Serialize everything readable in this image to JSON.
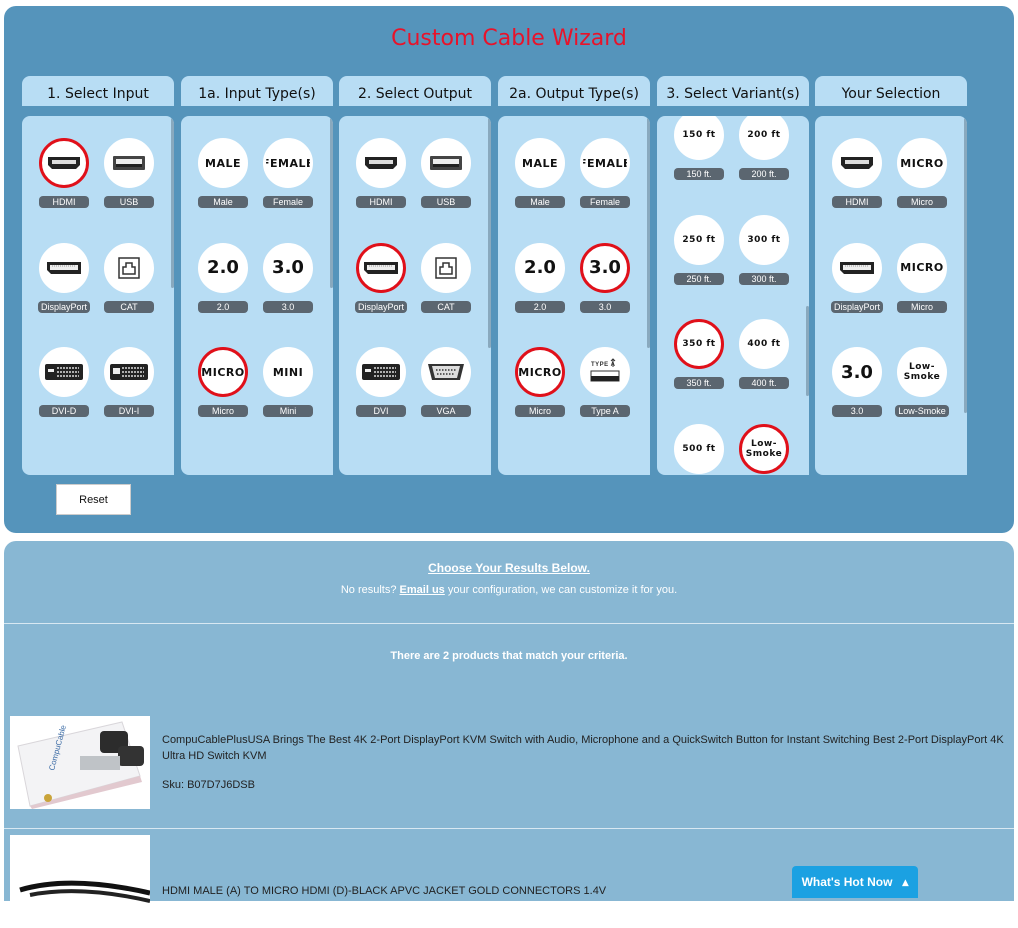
{
  "wizard": {
    "title": "Custom Cable Wizard",
    "reset_label": "Reset",
    "columns": [
      {
        "title": "1. Select Input",
        "options": [
          {
            "icon": "hdmi-port-icon",
            "label": "HDMI",
            "selected": true
          },
          {
            "icon": "usb-port-icon",
            "label": "USB",
            "selected": false
          },
          {
            "icon": "displayport-icon",
            "label": "DisplayPort",
            "selected": false
          },
          {
            "icon": "cat-port-icon",
            "label": "CAT",
            "selected": false
          },
          {
            "icon": "dvi-d-port-icon",
            "label": "DVI-D",
            "selected": false
          },
          {
            "icon": "dvi-i-port-icon",
            "label": "DVI-I",
            "selected": false
          }
        ]
      },
      {
        "title": "1a. Input Type(s)",
        "options": [
          {
            "text": "MALE",
            "label": "Male",
            "selected": false
          },
          {
            "text": "FEMALE",
            "label": "Female",
            "selected": false
          },
          {
            "text": "2.0",
            "label": "2.0",
            "selected": false
          },
          {
            "text": "3.0",
            "label": "3.0",
            "selected": false
          },
          {
            "text": "MICRO",
            "label": "Micro",
            "selected": true
          },
          {
            "text": "MINI",
            "label": "Mini",
            "selected": false
          }
        ]
      },
      {
        "title": "2. Select Output",
        "options": [
          {
            "icon": "hdmi-port-icon",
            "label": "HDMI",
            "selected": false
          },
          {
            "icon": "usb-port-icon",
            "label": "USB",
            "selected": false
          },
          {
            "icon": "displayport-icon",
            "label": "DisplayPort",
            "selected": true
          },
          {
            "icon": "cat-port-icon",
            "label": "CAT",
            "selected": false
          },
          {
            "icon": "dvi-port-icon",
            "label": "DVI",
            "selected": false
          },
          {
            "icon": "vga-port-icon",
            "label": "VGA",
            "selected": false
          }
        ]
      },
      {
        "title": "2a. Output Type(s)",
        "options": [
          {
            "text": "MALE",
            "label": "Male",
            "selected": false
          },
          {
            "text": "FEMALE",
            "label": "Female",
            "selected": false
          },
          {
            "text": "2.0",
            "label": "2.0",
            "selected": false
          },
          {
            "text": "3.0",
            "label": "3.0",
            "selected": true
          },
          {
            "text": "MICRO",
            "label": "Micro",
            "selected": true
          },
          {
            "icon": "usb-type-a-icon",
            "label": "Type A",
            "selected": false
          }
        ]
      },
      {
        "title": "3. Select Variant(s)",
        "options": [
          {
            "text": "150 ft",
            "label": "150 ft.",
            "selected": false
          },
          {
            "text": "200 ft",
            "label": "200 ft.",
            "selected": false
          },
          {
            "text": "250 ft",
            "label": "250 ft.",
            "selected": false
          },
          {
            "text": "300 ft",
            "label": "300 ft.",
            "selected": false
          },
          {
            "text": "350 ft",
            "label": "350 ft.",
            "selected": true
          },
          {
            "text": "400 ft",
            "label": "400 ft.",
            "selected": false
          },
          {
            "text": "500 ft",
            "label": "",
            "selected": false
          },
          {
            "text": "Low-\nSmoke",
            "label": "",
            "selected": true
          }
        ]
      },
      {
        "title": "Your Selection",
        "options": [
          {
            "icon": "hdmi-port-icon",
            "label": "HDMI",
            "selected": false
          },
          {
            "text": "MICRO",
            "label": "Micro",
            "selected": false
          },
          {
            "icon": "displayport-icon",
            "label": "DisplayPort",
            "selected": false
          },
          {
            "text": "MICRO",
            "label": "Micro",
            "selected": false
          },
          {
            "text": "3.0",
            "label": "3.0",
            "selected": false
          },
          {
            "text": "Low-\nSmoke",
            "label": "Low-Smoke",
            "selected": false
          }
        ]
      }
    ]
  },
  "results": {
    "title": "Choose Your Results Below.",
    "no_results_prefix": "No results?",
    "email_link": "Email us",
    "no_results_suffix": "your configuration, we can customize it for you.",
    "match_text": "There are 2 products that match your criteria.",
    "products": [
      {
        "name": "CompuCablePlusUSA Brings The Best 4K 2-Port DisplayPort KVM Switch with Audio, Microphone and a QuickSwitch Button for Instant Switching Best 2-Port DisplayPort 4K Ultra HD Switch KVM",
        "sku": "Sku: B07D7J6DSB"
      },
      {
        "name": "HDMI MALE (A) TO MICRO HDMI (D)-BLACK APVC JACKET GOLD CONNECTORS 1.4V",
        "sku": ""
      }
    ]
  },
  "hot_button": "What's Hot Now"
}
